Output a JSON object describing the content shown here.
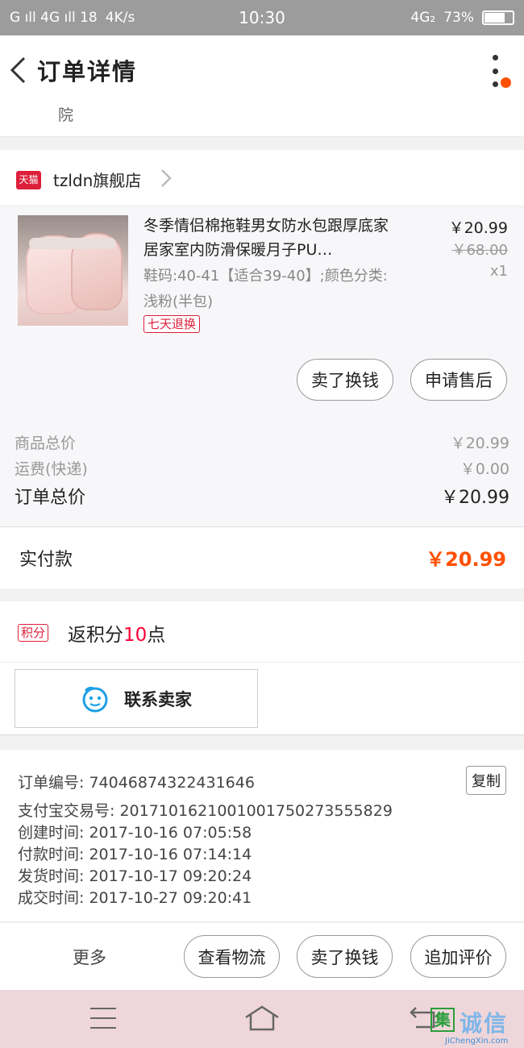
{
  "status_bar": {
    "left_text": "G ıll 4G ıll 18",
    "speed": "4K/s",
    "time": "10:30",
    "network": "4G₂",
    "battery": "73%"
  },
  "header": {
    "title": "订单详情"
  },
  "address_tail": "院",
  "shop": {
    "name": "tzldn旗舰店",
    "platform_badge": "天猫"
  },
  "item": {
    "title": "冬季情侣棉拖鞋男女防水包跟厚底家居家室内防滑保暖月子PU…",
    "sku": "鞋码:40-41【适合39-40】;颜色分类:浅粉(半包)",
    "badge": "七天退换",
    "price_now": "￥20.99",
    "price_old": "￥68.00",
    "qty": "x1",
    "buttons": {
      "sell": "卖了换钱",
      "after_sale": "申请售后"
    }
  },
  "totals": {
    "goods_label": "商品总价",
    "goods_value": "￥20.99",
    "shipping_label": "运费(快递)",
    "shipping_value": "￥0.00",
    "order_label": "订单总价",
    "order_value": "￥20.99"
  },
  "paid": {
    "label": "实付款",
    "value": "￥20.99"
  },
  "points": {
    "badge": "积分",
    "prefix": "返积分",
    "num": "10",
    "suffix": "点"
  },
  "contact": {
    "label": "联系卖家"
  },
  "info": {
    "order_no": "订单编号: 740468743224316​46",
    "alipay_no": "支付宝交易号: 2017101621001001750273555829",
    "created": "创建时间: 2017-10-16  07:05:58",
    "paid_time": "付款时间: 2017-10-16  07:14:14",
    "shipped": "发货时间: 2017-10-17  09:20:24",
    "done": "成交时间: 2017-10-27  09:20:41",
    "copy": "复制"
  },
  "actions": {
    "more": "更多",
    "logistics": "查看物流",
    "sell": "卖了换钱",
    "review": "追加评价"
  },
  "watermark": {
    "mark": "集",
    "cn": "诚信",
    "en": "JiChengXin.com"
  }
}
